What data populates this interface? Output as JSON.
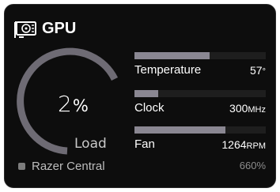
{
  "widget": {
    "title": "GPU",
    "icon": "gpu-card-icon",
    "load": {
      "value": "2",
      "unit": "%",
      "label": "Load",
      "fraction": 0.02
    },
    "source_label": "Razer Central",
    "footer_value": "660%"
  },
  "metrics": [
    {
      "label": "Temperature",
      "value": "57",
      "unit": "°",
      "fraction": 0.57
    },
    {
      "label": "Clock",
      "value": "300",
      "unit": "MHz",
      "fraction": 0.18
    },
    {
      "label": "Fan",
      "value": "1264",
      "unit": "RPM",
      "fraction": 0.69
    }
  ],
  "colors": {
    "background": "#0d0d0d",
    "gauge_arc": "#6e6b74",
    "gauge_track": "#1e1e1e",
    "bar_fill": "#8a8792",
    "bar_track": "#1e1e1e",
    "text": "#ffffff",
    "muted_text": "#8d8d8d"
  }
}
